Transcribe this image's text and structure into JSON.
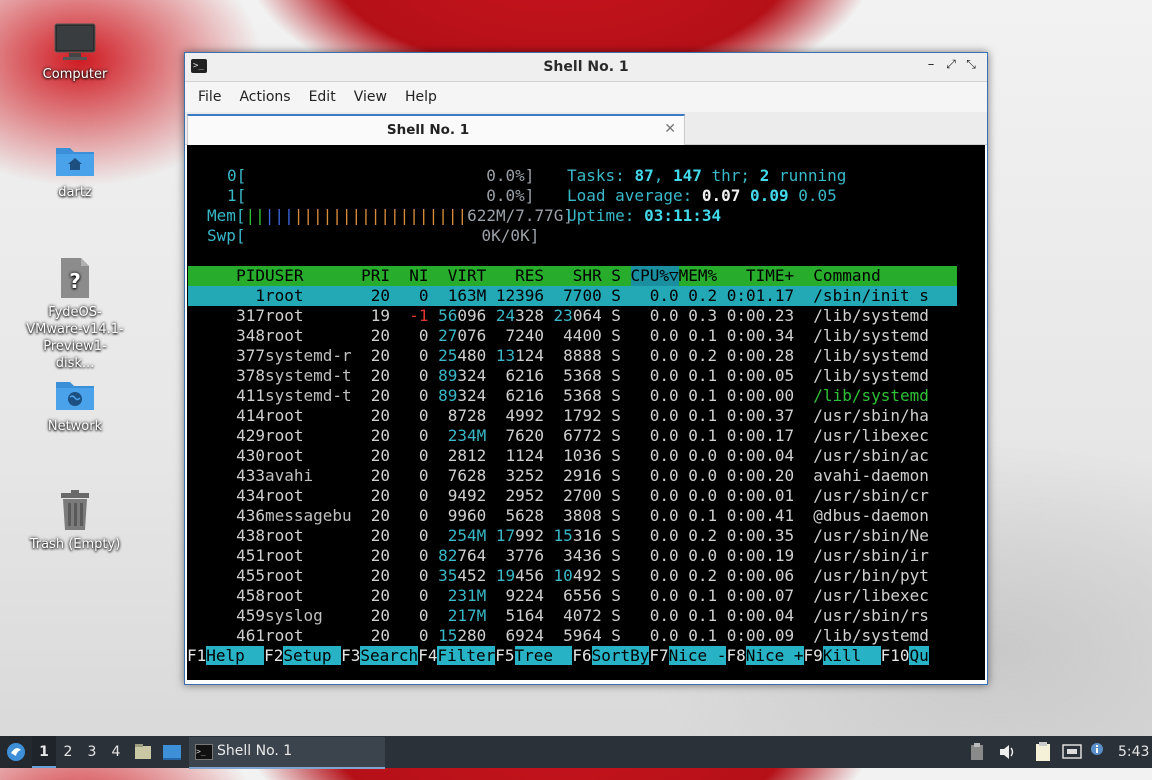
{
  "desktop": {
    "icons": [
      {
        "label": "Computer"
      },
      {
        "label": "dartz"
      },
      {
        "label": "FydeOS-VMware-v14.1-Preview1-disk..."
      },
      {
        "label": "Network"
      },
      {
        "label": "Trash (Empty)"
      }
    ]
  },
  "window": {
    "title": "Shell No. 1",
    "controls": {
      "minimize": "–",
      "restore": "⤢",
      "maximize": "⤡",
      "close": "✕"
    },
    "menu": [
      "File",
      "Actions",
      "Edit",
      "View",
      "Help"
    ],
    "tab": {
      "label": "Shell No. 1",
      "close": "✕"
    }
  },
  "htop": {
    "cpu0": {
      "label": "0[",
      "value": "0.0%]"
    },
    "cpu1": {
      "label": "1[",
      "value": "0.0%]"
    },
    "mem": {
      "label": "Mem[",
      "bars": "||||||||||||||||||",
      "value": "622M/7.77G]"
    },
    "swp": {
      "label": "Swp[",
      "value": "0K/0K]"
    },
    "tasks": {
      "prefix": "Tasks:",
      "tasks": "87",
      "sep": ",",
      "threads": "147",
      "thr_label": "thr;",
      "running": "2",
      "running_label": "running"
    },
    "load": {
      "prefix": "Load average:",
      "l1": "0.07",
      "l5": "0.09",
      "l15": "0.05"
    },
    "uptime": {
      "prefix": "Uptime:",
      "value": "03:11:34"
    },
    "header": {
      "pid": "PID",
      "user": "USER",
      "pri": "PRI",
      "ni": "NI",
      "virt": "VIRT",
      "res": "RES",
      "shr": "SHR",
      "s": "S",
      "cpu": "CPU%▽",
      "mem": "MEM%",
      "time": "TIME+",
      "command": "Command"
    },
    "rows": [
      {
        "pid": "1",
        "user": "root",
        "pri": "20",
        "ni": "0",
        "virt": "163M",
        "res": "12396",
        "shr": "7700",
        "s": "S",
        "cpu": "0.0",
        "mem": "0.2",
        "time": "0:01.17",
        "cmd": "/sbin/init s"
      },
      {
        "pid": "317",
        "user": "root",
        "pri": "19",
        "ni": "-1",
        "virt": "56096",
        "res": "24328",
        "shr": "23064",
        "s": "S",
        "cpu": "0.0",
        "mem": "0.3",
        "time": "0:00.23",
        "cmd": "/lib/systemd"
      },
      {
        "pid": "348",
        "user": "root",
        "pri": "20",
        "ni": "0",
        "virt": "27076",
        "res": "7240",
        "shr": "4400",
        "s": "S",
        "cpu": "0.0",
        "mem": "0.1",
        "time": "0:00.34",
        "cmd": "/lib/systemd"
      },
      {
        "pid": "377",
        "user": "systemd-r",
        "pri": "20",
        "ni": "0",
        "virt": "25480",
        "res": "13124",
        "shr": "8888",
        "s": "S",
        "cpu": "0.0",
        "mem": "0.2",
        "time": "0:00.28",
        "cmd": "/lib/systemd"
      },
      {
        "pid": "378",
        "user": "systemd-t",
        "pri": "20",
        "ni": "0",
        "virt": "89324",
        "res": "6216",
        "shr": "5368",
        "s": "S",
        "cpu": "0.0",
        "mem": "0.1",
        "time": "0:00.05",
        "cmd": "/lib/systemd"
      },
      {
        "pid": "411",
        "user": "systemd-t",
        "pri": "20",
        "ni": "0",
        "virt": "89324",
        "res": "6216",
        "shr": "5368",
        "s": "S",
        "cpu": "0.0",
        "mem": "0.1",
        "time": "0:00.00",
        "cmd": "/lib/systemd"
      },
      {
        "pid": "414",
        "user": "root",
        "pri": "20",
        "ni": "0",
        "virt": "8728",
        "res": "4992",
        "shr": "1792",
        "s": "S",
        "cpu": "0.0",
        "mem": "0.1",
        "time": "0:00.37",
        "cmd": "/usr/sbin/ha"
      },
      {
        "pid": "429",
        "user": "root",
        "pri": "20",
        "ni": "0",
        "virt": "234M",
        "res": "7620",
        "shr": "6772",
        "s": "S",
        "cpu": "0.0",
        "mem": "0.1",
        "time": "0:00.17",
        "cmd": "/usr/libexec"
      },
      {
        "pid": "430",
        "user": "root",
        "pri": "20",
        "ni": "0",
        "virt": "2812",
        "res": "1124",
        "shr": "1036",
        "s": "S",
        "cpu": "0.0",
        "mem": "0.0",
        "time": "0:00.04",
        "cmd": "/usr/sbin/ac"
      },
      {
        "pid": "433",
        "user": "avahi",
        "pri": "20",
        "ni": "0",
        "virt": "7628",
        "res": "3252",
        "shr": "2916",
        "s": "S",
        "cpu": "0.0",
        "mem": "0.0",
        "time": "0:00.20",
        "cmd": "avahi-daemon"
      },
      {
        "pid": "434",
        "user": "root",
        "pri": "20",
        "ni": "0",
        "virt": "9492",
        "res": "2952",
        "shr": "2700",
        "s": "S",
        "cpu": "0.0",
        "mem": "0.0",
        "time": "0:00.01",
        "cmd": "/usr/sbin/cr"
      },
      {
        "pid": "436",
        "user": "messagebu",
        "pri": "20",
        "ni": "0",
        "virt": "9960",
        "res": "5628",
        "shr": "3808",
        "s": "S",
        "cpu": "0.0",
        "mem": "0.1",
        "time": "0:00.41",
        "cmd": "@dbus-daemon"
      },
      {
        "pid": "438",
        "user": "root",
        "pri": "20",
        "ni": "0",
        "virt": "254M",
        "res": "17992",
        "shr": "15316",
        "s": "S",
        "cpu": "0.0",
        "mem": "0.2",
        "time": "0:00.35",
        "cmd": "/usr/sbin/Ne"
      },
      {
        "pid": "451",
        "user": "root",
        "pri": "20",
        "ni": "0",
        "virt": "82764",
        "res": "3776",
        "shr": "3436",
        "s": "S",
        "cpu": "0.0",
        "mem": "0.0",
        "time": "0:00.19",
        "cmd": "/usr/sbin/ir"
      },
      {
        "pid": "455",
        "user": "root",
        "pri": "20",
        "ni": "0",
        "virt": "35452",
        "res": "19456",
        "shr": "10492",
        "s": "S",
        "cpu": "0.0",
        "mem": "0.2",
        "time": "0:00.06",
        "cmd": "/usr/bin/pyt"
      },
      {
        "pid": "458",
        "user": "root",
        "pri": "20",
        "ni": "0",
        "virt": "231M",
        "res": "9224",
        "shr": "6556",
        "s": "S",
        "cpu": "0.0",
        "mem": "0.1",
        "time": "0:00.07",
        "cmd": "/usr/libexec"
      },
      {
        "pid": "459",
        "user": "syslog",
        "pri": "20",
        "ni": "0",
        "virt": "217M",
        "res": "5164",
        "shr": "4072",
        "s": "S",
        "cpu": "0.0",
        "mem": "0.1",
        "time": "0:00.04",
        "cmd": "/usr/sbin/rs"
      },
      {
        "pid": "461",
        "user": "root",
        "pri": "20",
        "ni": "0",
        "virt": "15280",
        "res": "6924",
        "shr": "5964",
        "s": "S",
        "cpu": "0.0",
        "mem": "0.1",
        "time": "0:00.09",
        "cmd": "/lib/systemd"
      }
    ],
    "fkeys": [
      {
        "key": "F1",
        "label": "Help  "
      },
      {
        "key": "F2",
        "label": "Setup "
      },
      {
        "key": "F3",
        "label": "Search"
      },
      {
        "key": "F4",
        "label": "Filter"
      },
      {
        "key": "F5",
        "label": "Tree  "
      },
      {
        "key": "F6",
        "label": "SortBy"
      },
      {
        "key": "F7",
        "label": "Nice -"
      },
      {
        "key": "F8",
        "label": "Nice +"
      },
      {
        "key": "F9",
        "label": "Kill  "
      },
      {
        "key": "F10",
        "label": "Qu"
      }
    ]
  },
  "taskbar": {
    "workspaces": [
      "1",
      "2",
      "3",
      "4"
    ],
    "task_label": "Shell No. 1",
    "clock": "5:43"
  },
  "colors": {
    "htop_header": "#27ad2b",
    "htop_selected": "#23a8b6",
    "taskbar": "#2b3138",
    "window_border": "#3a6fb0"
  }
}
